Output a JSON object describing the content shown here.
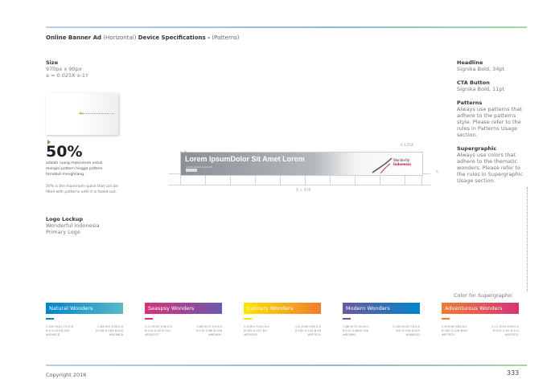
{
  "page": {
    "title_bold": "Online Banner Ad",
    "title_thin1": "(Horizontal)",
    "title_bold2": "Device Specifications -",
    "title_thin2": "(Patterns)"
  },
  "size": {
    "label": "Size",
    "line1": "970px x 90px",
    "line2": "a = 0.025X x-1Y"
  },
  "highlight": {
    "percent": "50%",
    "desc": "adalah ruang maksimum untuk mengisi pattern hingga pattern tersebut menghilang.",
    "desc_en": "50% is the maximum space that can be filled with patterns until it is faded-out."
  },
  "logo_lockup": {
    "label": "Logo Lockup",
    "line1": "Wonderful Indonesia",
    "line2": "Primary Logo"
  },
  "banner": {
    "headline": "Lorem IpsumDolor Sit Amet Lorem",
    "subline": "Lorem ipsum dolor sit",
    "logo_line1": "Wonderful",
    "logo_line2": "Indonesia",
    "dim_top": "0.125X",
    "dim_bottom": "X = 970",
    "dim_side": "a",
    "dim_left": "a"
  },
  "right": {
    "headline_label": "Headline",
    "headline_val": "Signika Bold, 34pt",
    "cta_label": "CTA Button",
    "cta_val": "Signika Bold, 11pt",
    "patterns_label": "Patterns",
    "patterns_val": "Always use patterns that adhere to the patterns style. Please refer to the rules in Patterns Usage section.",
    "super_label": "Supergraphic",
    "super_val": "Always use colors that adhere to the thematic wonders. Please refer to the rules in Supergraphic Usage section."
  },
  "supergraphic_title": "Color for Supergraphic",
  "swatches": [
    {
      "name": "Natural Wonders",
      "from": "#0085CD",
      "to": "#5BB8C8",
      "c1": [
        "C:100 M:25 Y:0 K:0",
        "R:0 G:134 B:205",
        "#0085CD"
      ],
      "c2": [
        "C:65 M:0 Y:30 K:0",
        "R:108 G:183 B:200",
        "#6CB6C8"
      ]
    },
    {
      "name": "Seaspsy Wonders",
      "from": "#D5337C",
      "to": "#6E56AC",
      "c1": [
        "C:11 M:93 Y:56 K:0",
        "R:214 G:52 B:124",
        "#D5337C"
      ],
      "c2": [
        "C:68 M:75 Y:0 K:0",
        "R:110 G:86 B:156",
        "#6E569C"
      ]
    },
    {
      "name": "Culinary Wonders",
      "from": "#FFE500",
      "to": "#F07C31",
      "c1": [
        "C:4 M:0 Y:100 K:0",
        "R:255 G:237 B:0",
        "#FFED00"
      ],
      "c2": [
        "C:0 M:65 Y:85 K:0",
        "R:240 G:126 B:49",
        "#EF7E31"
      ]
    },
    {
      "name": "Modern Wonders",
      "from": "#6E569C",
      "to": "#0085CD",
      "c1": [
        "C:68 M:75 Y:0 K:0",
        "R:110 G:86 B:156",
        "#6E569C"
      ],
      "c2": [
        "C:100 M:25 Y:0 K:0",
        "R:0 G:134 B:205",
        "#0085CD"
      ]
    },
    {
      "name": "Adventurous Wonders",
      "from": "#F07C31",
      "to": "#D5337C",
      "c1": [
        "C:0 M:65 Y:85 K:0",
        "R:240 G:126 B:49",
        "#EF7E31"
      ],
      "c2": [
        "C:11 M:93 Y:56 K:0",
        "R:214 G:52 B:124",
        "#D5337C"
      ]
    }
  ],
  "footer": {
    "copyright": "Copyright 2016",
    "page_number": "333"
  }
}
